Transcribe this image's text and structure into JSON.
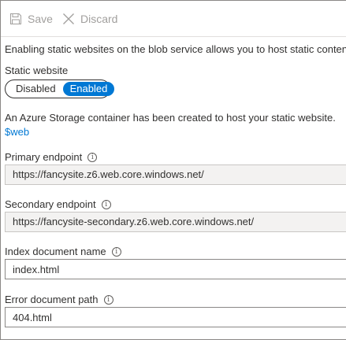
{
  "toolbar": {
    "save_label": "Save",
    "discard_label": "Discard"
  },
  "description": "Enabling static websites on the blob service allows you to host static conten",
  "static_website": {
    "label": "Static website",
    "options": [
      "Disabled",
      "Enabled"
    ],
    "selected": "Enabled"
  },
  "notice": {
    "text": "An Azure Storage container has been created to host your static website.",
    "link": "$web"
  },
  "primary_endpoint": {
    "label": "Primary endpoint",
    "value": "https://fancysite.z6.web.core.windows.net/"
  },
  "secondary_endpoint": {
    "label": "Secondary endpoint",
    "value": "https://fancysite-secondary.z6.web.core.windows.net/"
  },
  "index_document": {
    "label": "Index document name",
    "value": "index.html"
  },
  "error_document": {
    "label": "Error document path",
    "value": "404.html"
  },
  "colors": {
    "accent": "#0078d4",
    "disabled_text": "#a19f9d",
    "readonly_bg": "#f3f2f1"
  }
}
